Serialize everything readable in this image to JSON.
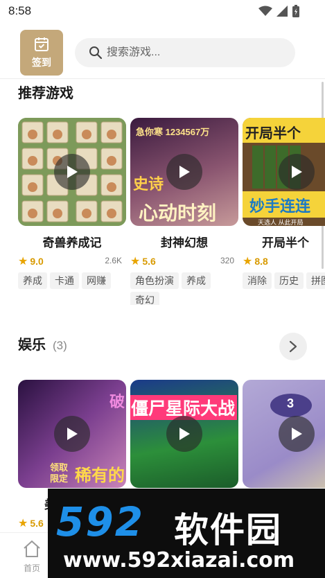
{
  "status_bar": {
    "time": "8:58"
  },
  "header": {
    "checkin_label": "签到",
    "search_placeholder": "搜索游戏..."
  },
  "recommended": {
    "title": "推荐游戏",
    "games": [
      {
        "name": "奇兽养成记",
        "rating": "9.0",
        "plays": "2.6K",
        "tags": [
          "养成",
          "卡通",
          "网赚"
        ]
      },
      {
        "name": "封神幻想",
        "rating": "5.6",
        "plays": "320",
        "tags": [
          "角色扮演",
          "养成",
          "奇幻"
        ],
        "thumb_text_top": "急你寒 1234567万",
        "thumb_text_mid": "史诗",
        "thumb_text_bottom": "心动时刻"
      },
      {
        "name": "开局半个",
        "rating": "8.8",
        "plays": "",
        "tags": [
          "消除",
          "历史",
          "拼图"
        ],
        "thumb_text_top": "开局半个",
        "thumb_text_bottom": "妙手连连",
        "thumb_text_small": "天选人 从此开局"
      }
    ]
  },
  "entertainment": {
    "title": "娱乐",
    "count": "(3)",
    "games": [
      {
        "name": "美",
        "rating": "5.6",
        "thumb_text_a": "领取",
        "thumb_text_b": "限定",
        "thumb_text_c": "稀有的",
        "thumb_text_d": "破"
      },
      {
        "thumb_text": "僵尸星际大战"
      },
      {
        "thumb_text": "3"
      }
    ]
  },
  "bottom_nav": {
    "home_label": "首页"
  },
  "watermark": {
    "logo": "592",
    "name": "软件园",
    "url": "www.592xiazai.com"
  },
  "colors": {
    "accent_gold": "#c4a87a",
    "star": "#e8a400",
    "watermark_blue": "#1e8fe8"
  }
}
